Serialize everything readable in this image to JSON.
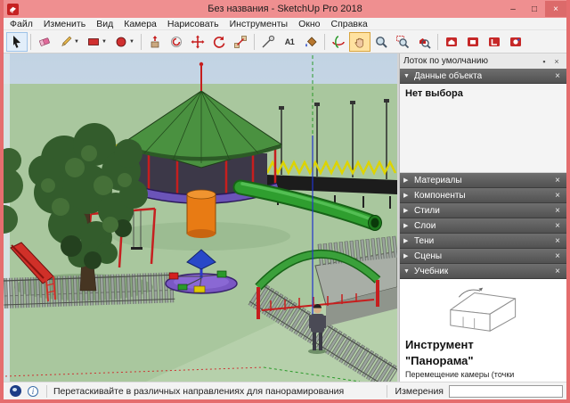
{
  "window": {
    "title": "Без названия - SketchUp Pro 2018"
  },
  "icons": {
    "expanded": "▼",
    "collapsed": "▶",
    "close": "×",
    "pin": "▪",
    "minimize": "–",
    "maximize": "□",
    "info": "i"
  },
  "menu": {
    "items": [
      "Файл",
      "Изменить",
      "Вид",
      "Камера",
      "Нарисовать",
      "Инструменты",
      "Окно",
      "Справка"
    ]
  },
  "toolbar": {
    "text_tool_label": "A1",
    "active_tool": "pan",
    "tools": [
      "select",
      "eraser",
      "line",
      "rectangle",
      "circle",
      "push-pull",
      "offset",
      "move",
      "rotate",
      "scale",
      "tape-measure",
      "dimensions",
      "paint-bucket",
      "orbit",
      "pan",
      "zoom",
      "zoom-window",
      "zoom-extents",
      "3d-warehouse",
      "extension-warehouse",
      "layout",
      "style-builder"
    ]
  },
  "tray": {
    "title": "Лоток по умолчанию",
    "panels": [
      {
        "label": "Данные объекта",
        "expanded": true
      },
      {
        "label": "Материалы",
        "expanded": false
      },
      {
        "label": "Компоненты",
        "expanded": false
      },
      {
        "label": "Стили",
        "expanded": false
      },
      {
        "label": "Слои",
        "expanded": false
      },
      {
        "label": "Тени",
        "expanded": false
      },
      {
        "label": "Сцены",
        "expanded": false
      },
      {
        "label": "Учебник",
        "expanded": true
      }
    ],
    "entity_info": {
      "message": "Нет выбора"
    },
    "instructor": {
      "title_line1": "Инструмент",
      "title_line2": "\"Панорама\"",
      "body": "Перемещение камеры (точки"
    }
  },
  "statusbar": {
    "hint": "Перетаскивайте в различных направлениях для панорамирования",
    "measurements_label": "Измерения",
    "measurements_value": ""
  }
}
